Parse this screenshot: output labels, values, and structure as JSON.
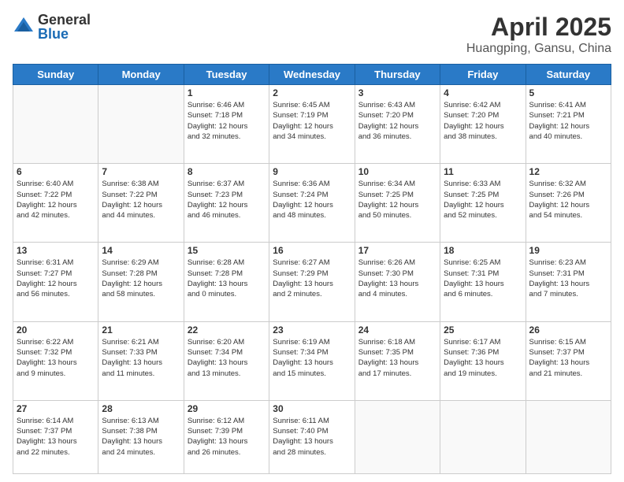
{
  "header": {
    "logo_general": "General",
    "logo_blue": "Blue",
    "title": "April 2025",
    "location": "Huangping, Gansu, China"
  },
  "weekdays": [
    "Sunday",
    "Monday",
    "Tuesday",
    "Wednesday",
    "Thursday",
    "Friday",
    "Saturday"
  ],
  "weeks": [
    [
      {
        "day": "",
        "info": ""
      },
      {
        "day": "",
        "info": ""
      },
      {
        "day": "1",
        "info": "Sunrise: 6:46 AM\nSunset: 7:18 PM\nDaylight: 12 hours\nand 32 minutes."
      },
      {
        "day": "2",
        "info": "Sunrise: 6:45 AM\nSunset: 7:19 PM\nDaylight: 12 hours\nand 34 minutes."
      },
      {
        "day": "3",
        "info": "Sunrise: 6:43 AM\nSunset: 7:20 PM\nDaylight: 12 hours\nand 36 minutes."
      },
      {
        "day": "4",
        "info": "Sunrise: 6:42 AM\nSunset: 7:20 PM\nDaylight: 12 hours\nand 38 minutes."
      },
      {
        "day": "5",
        "info": "Sunrise: 6:41 AM\nSunset: 7:21 PM\nDaylight: 12 hours\nand 40 minutes."
      }
    ],
    [
      {
        "day": "6",
        "info": "Sunrise: 6:40 AM\nSunset: 7:22 PM\nDaylight: 12 hours\nand 42 minutes."
      },
      {
        "day": "7",
        "info": "Sunrise: 6:38 AM\nSunset: 7:22 PM\nDaylight: 12 hours\nand 44 minutes."
      },
      {
        "day": "8",
        "info": "Sunrise: 6:37 AM\nSunset: 7:23 PM\nDaylight: 12 hours\nand 46 minutes."
      },
      {
        "day": "9",
        "info": "Sunrise: 6:36 AM\nSunset: 7:24 PM\nDaylight: 12 hours\nand 48 minutes."
      },
      {
        "day": "10",
        "info": "Sunrise: 6:34 AM\nSunset: 7:25 PM\nDaylight: 12 hours\nand 50 minutes."
      },
      {
        "day": "11",
        "info": "Sunrise: 6:33 AM\nSunset: 7:25 PM\nDaylight: 12 hours\nand 52 minutes."
      },
      {
        "day": "12",
        "info": "Sunrise: 6:32 AM\nSunset: 7:26 PM\nDaylight: 12 hours\nand 54 minutes."
      }
    ],
    [
      {
        "day": "13",
        "info": "Sunrise: 6:31 AM\nSunset: 7:27 PM\nDaylight: 12 hours\nand 56 minutes."
      },
      {
        "day": "14",
        "info": "Sunrise: 6:29 AM\nSunset: 7:28 PM\nDaylight: 12 hours\nand 58 minutes."
      },
      {
        "day": "15",
        "info": "Sunrise: 6:28 AM\nSunset: 7:28 PM\nDaylight: 13 hours\nand 0 minutes."
      },
      {
        "day": "16",
        "info": "Sunrise: 6:27 AM\nSunset: 7:29 PM\nDaylight: 13 hours\nand 2 minutes."
      },
      {
        "day": "17",
        "info": "Sunrise: 6:26 AM\nSunset: 7:30 PM\nDaylight: 13 hours\nand 4 minutes."
      },
      {
        "day": "18",
        "info": "Sunrise: 6:25 AM\nSunset: 7:31 PM\nDaylight: 13 hours\nand 6 minutes."
      },
      {
        "day": "19",
        "info": "Sunrise: 6:23 AM\nSunset: 7:31 PM\nDaylight: 13 hours\nand 7 minutes."
      }
    ],
    [
      {
        "day": "20",
        "info": "Sunrise: 6:22 AM\nSunset: 7:32 PM\nDaylight: 13 hours\nand 9 minutes."
      },
      {
        "day": "21",
        "info": "Sunrise: 6:21 AM\nSunset: 7:33 PM\nDaylight: 13 hours\nand 11 minutes."
      },
      {
        "day": "22",
        "info": "Sunrise: 6:20 AM\nSunset: 7:34 PM\nDaylight: 13 hours\nand 13 minutes."
      },
      {
        "day": "23",
        "info": "Sunrise: 6:19 AM\nSunset: 7:34 PM\nDaylight: 13 hours\nand 15 minutes."
      },
      {
        "day": "24",
        "info": "Sunrise: 6:18 AM\nSunset: 7:35 PM\nDaylight: 13 hours\nand 17 minutes."
      },
      {
        "day": "25",
        "info": "Sunrise: 6:17 AM\nSunset: 7:36 PM\nDaylight: 13 hours\nand 19 minutes."
      },
      {
        "day": "26",
        "info": "Sunrise: 6:15 AM\nSunset: 7:37 PM\nDaylight: 13 hours\nand 21 minutes."
      }
    ],
    [
      {
        "day": "27",
        "info": "Sunrise: 6:14 AM\nSunset: 7:37 PM\nDaylight: 13 hours\nand 22 minutes."
      },
      {
        "day": "28",
        "info": "Sunrise: 6:13 AM\nSunset: 7:38 PM\nDaylight: 13 hours\nand 24 minutes."
      },
      {
        "day": "29",
        "info": "Sunrise: 6:12 AM\nSunset: 7:39 PM\nDaylight: 13 hours\nand 26 minutes."
      },
      {
        "day": "30",
        "info": "Sunrise: 6:11 AM\nSunset: 7:40 PM\nDaylight: 13 hours\nand 28 minutes."
      },
      {
        "day": "",
        "info": ""
      },
      {
        "day": "",
        "info": ""
      },
      {
        "day": "",
        "info": ""
      }
    ]
  ]
}
